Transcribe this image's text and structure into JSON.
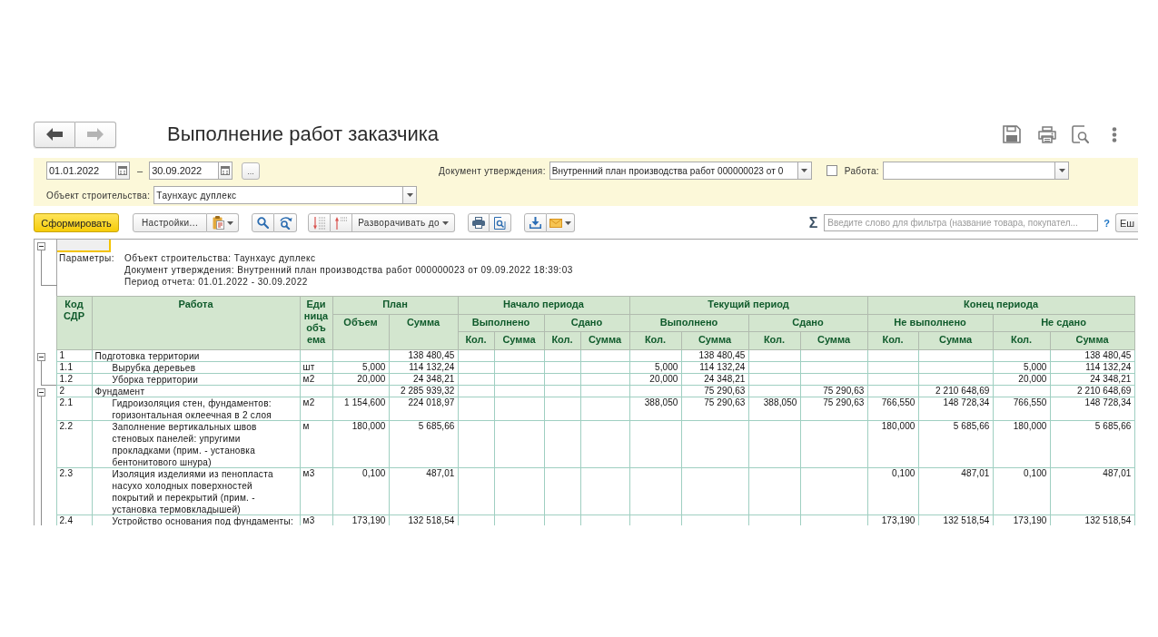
{
  "window": {
    "title": "Выполнение работ заказчика"
  },
  "navigation": {
    "back": {
      "disabled": false
    },
    "forward": {
      "disabled": true
    }
  },
  "filters": {
    "period": {
      "from": "01.01.2022",
      "separator": "–",
      "to": "30.09.2022",
      "more_button": "..."
    },
    "approval_document": {
      "label": "Документ утверждения:",
      "value": "Внутренний план производства работ 000000023 от 0"
    },
    "work": {
      "checked": false,
      "label": "Работа:"
    },
    "construction_object": {
      "label": "Объект строительства:",
      "value": "Таунхаус дуплекс"
    }
  },
  "toolbar": {
    "generate_button": "Сформировать",
    "settings_button": "Настройки...",
    "expand_to_button": "Разворачивать до",
    "sum_button": "Σ",
    "filter": {
      "placeholder": "Введите слово для фильтра (название товара, покупател..."
    },
    "help_button": "?",
    "more_button": "Еш"
  },
  "report": {
    "parameters": {
      "expanded": true,
      "label": "Параметры:",
      "lines": [
        "Объект строительства: Таунхаус дуплекс",
        "Документ утверждения: Внутренний план производства работ 000000023 от 09.09.2022 18:39:03",
        "Период отчета: 01.01.2022 - 30.09.2022"
      ]
    },
    "table": {
      "columns": [
        {
          "label": "Код СДР"
        },
        {
          "label": "Работа"
        },
        {
          "label": "Единица объема"
        },
        {
          "label": "План",
          "children": [
            {
              "label": "Объем"
            },
            {
              "label": "Сумма"
            }
          ]
        },
        {
          "label": "Начало периода",
          "children": [
            {
              "label": "Выполнено",
              "children": [
                {
                  "label": "Кол."
                },
                {
                  "label": "Сумма"
                }
              ]
            },
            {
              "label": "Сдано",
              "children": [
                {
                  "label": "Кол."
                },
                {
                  "label": "Сумма"
                }
              ]
            }
          ]
        },
        {
          "label": "Текущий период",
          "children": [
            {
              "label": "Выполнено",
              "children": [
                {
                  "label": "Кол."
                },
                {
                  "label": "Сумма"
                }
              ]
            },
            {
              "label": "Сдано",
              "children": [
                {
                  "label": "Кол."
                },
                {
                  "label": "Сумма"
                }
              ]
            }
          ]
        },
        {
          "label": "Конец периода",
          "children": [
            {
              "label": "Не выполнено",
              "children": [
                {
                  "label": "Кол."
                },
                {
                  "label": "Сумма"
                }
              ]
            },
            {
              "label": "Не сдано",
              "children": [
                {
                  "label": "Кол."
                },
                {
                  "label": "Сумма"
                }
              ]
            }
          ]
        }
      ],
      "rows": [
        {
          "code": "1",
          "work": "Подготовка территории",
          "expanded": true,
          "values": {
            "plan_sum": "138 480,45",
            "current_done_sum": "138 480,45",
            "end_not_delivered_sum": "138 480,45"
          },
          "children": [
            {
              "code": "1.1",
              "work": "Вырубка деревьев",
              "unit": "шт",
              "values": {
                "plan_volume": "5,000",
                "plan_sum": "114 132,24",
                "current_done_qty": "5,000",
                "current_done_sum": "114 132,24",
                "end_not_delivered_qty": "5,000",
                "end_not_delivered_sum": "114 132,24"
              }
            },
            {
              "code": "1.2",
              "work": "Уборка территории",
              "unit": "м2",
              "values": {
                "plan_volume": "20,000",
                "plan_sum": "24 348,21",
                "current_done_qty": "20,000",
                "current_done_sum": "24 348,21",
                "end_not_delivered_qty": "20,000",
                "end_not_delivered_sum": "24 348,21"
              }
            }
          ]
        },
        {
          "code": "2",
          "work": "Фундамент",
          "expanded": true,
          "values": {
            "plan_sum": "2 285 939,32",
            "current_done_sum": "75 290,63",
            "current_delivered_sum": "75 290,63",
            "end_not_done_sum": "2 210 648,69",
            "end_not_delivered_sum": "2 210 648,69"
          },
          "children": [
            {
              "code": "2.1",
              "work": "Гидроизоляция стен, фундаментов: горизонтальная оклеечная в 2 слоя",
              "unit": "м2",
              "values": {
                "plan_volume": "1 154,600",
                "plan_sum": "224 018,97",
                "current_done_qty": "388,050",
                "current_done_sum": "75 290,63",
                "current_delivered_qty": "388,050",
                "current_delivered_sum": "75 290,63",
                "end_not_done_qty": "766,550",
                "end_not_done_sum": "148 728,34",
                "end_not_delivered_qty": "766,550",
                "end_not_delivered_sum": "148 728,34"
              }
            },
            {
              "code": "2.2",
              "work": "Заполнение вертикальных швов стеновых панелей: упругими прокладками (прим. - установка бентонитового шнура)",
              "unit": "м",
              "values": {
                "plan_volume": "180,000",
                "plan_sum": "5 685,66",
                "end_not_done_qty": "180,000",
                "end_not_done_sum": "5 685,66",
                "end_not_delivered_qty": "180,000",
                "end_not_delivered_sum": "5 685,66"
              }
            },
            {
              "code": "2.3",
              "work": "Изоляция изделиями из пенопласта насухо холодных поверхностей покрытий и перекрытий (прим. - установка термовкладышей)",
              "unit": "м3",
              "values": {
                "plan_volume": "0,100",
                "plan_sum": "487,01",
                "end_not_done_qty": "0,100",
                "end_not_done_sum": "487,01",
                "end_not_delivered_qty": "0,100",
                "end_not_delivered_sum": "487,01"
              }
            },
            {
              "code": "2.4",
              "work": "Устройство основания под фундаменты:",
              "unit": "м3",
              "values": {
                "plan_volume": "173,190",
                "plan_sum": "132 518,54",
                "end_not_done_qty": "173,190",
                "end_not_done_sum": "132 518,54",
                "end_not_delivered_qty": "173,190",
                "end_not_delivered_sum": "132 518,54"
              }
            }
          ]
        }
      ]
    }
  }
}
